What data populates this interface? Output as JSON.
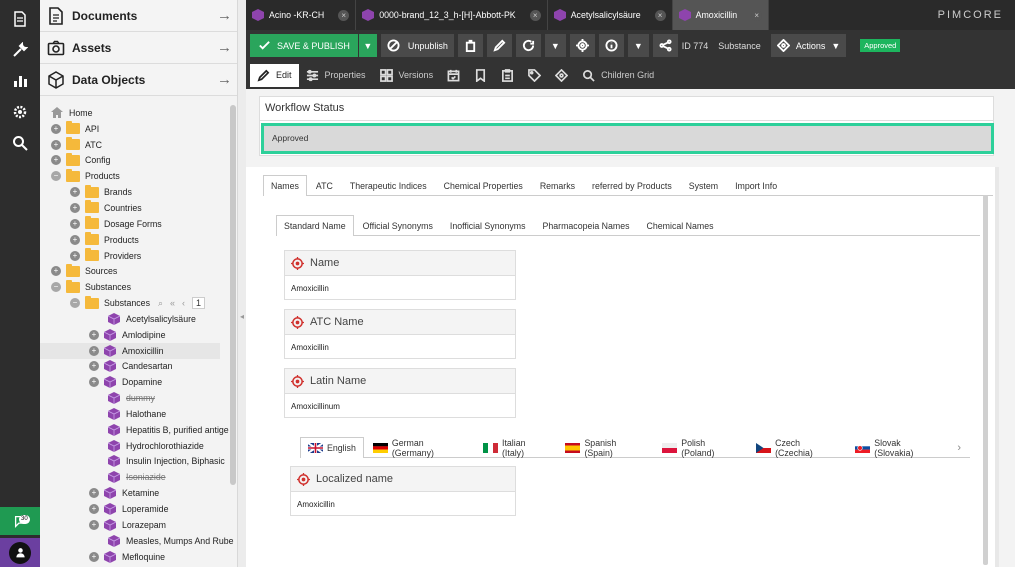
{
  "rail": {
    "notification_count": "30"
  },
  "tree": {
    "sections": [
      {
        "label": "Documents"
      },
      {
        "label": "Assets"
      },
      {
        "label": "Data Objects"
      }
    ],
    "nodes": [
      {
        "label": "Home"
      },
      {
        "label": "API"
      },
      {
        "label": "ATC"
      },
      {
        "label": "Config"
      },
      {
        "label": "Products"
      },
      {
        "label": "Brands"
      },
      {
        "label": "Countries"
      },
      {
        "label": "Dosage Forms"
      },
      {
        "label": "Products"
      },
      {
        "label": "Providers"
      },
      {
        "label": "Sources"
      },
      {
        "label": "Substances"
      },
      {
        "label": "Substances"
      },
      {
        "label": "Acetylsalicylsäure"
      },
      {
        "label": "Amlodipine"
      },
      {
        "label": "Amoxicillin"
      },
      {
        "label": "Candesartan"
      },
      {
        "label": "Dopamine"
      },
      {
        "label": "dummy"
      },
      {
        "label": "Halothane"
      },
      {
        "label": "Hepatitis B, purified antige"
      },
      {
        "label": "Hydrochlorothiazide"
      },
      {
        "label": "Insulin Injection, Biphasic"
      },
      {
        "label": "Isoniazide"
      },
      {
        "label": "Ketamine"
      },
      {
        "label": "Loperamide"
      },
      {
        "label": "Lorazepam"
      },
      {
        "label": "Measles, Mumps And Rube"
      },
      {
        "label": "Mefloquine"
      }
    ],
    "page": "1"
  },
  "tabs": [
    {
      "label": "Acino -KR-CH"
    },
    {
      "label": "0000-brand_12_3_h-[H]-Abbott-PK"
    },
    {
      "label": "Acetylsalicylsäure"
    },
    {
      "label": "Amoxicillin"
    }
  ],
  "logo": "PIMCORE",
  "toolbar": {
    "save_publish": "SAVE & PUBLISH",
    "unpublish": "Unpublish",
    "id": "ID 774",
    "class": "Substance",
    "actions": "Actions",
    "status": "Approved"
  },
  "edit_tabs": {
    "edit": "Edit",
    "properties": "Properties",
    "versions": "Versions",
    "children_grid": "Children Grid"
  },
  "workflow": {
    "title": "Workflow Status",
    "status": "Approved"
  },
  "main_tabs": [
    "Names",
    "ATC",
    "Therapeutic Indices",
    "Chemical Properties",
    "Remarks",
    "referred by Products",
    "System",
    "Import Info"
  ],
  "sub_tabs": [
    "Standard Name",
    "Official Synonyms",
    "Inofficial Synonyms",
    "Pharmacopeia Names",
    "Chemical Names"
  ],
  "fields": [
    {
      "label": "Name",
      "value": "Amoxicillin"
    },
    {
      "label": "ATC Name",
      "value": "Amoxicillin"
    },
    {
      "label": "Latin Name",
      "value": "Amoxicillinum"
    }
  ],
  "lang_tabs": [
    "English",
    "German (Germany)",
    "Italian (Italy)",
    "Spanish (Spain)",
    "Polish (Poland)",
    "Czech (Czechia)",
    "Slovak (Slovakia)"
  ],
  "localized": {
    "label": "Localized name",
    "value": "Amoxicillin"
  },
  "colors": {
    "accent_green": "#2aa55c",
    "workflow_border": "#2dd09a",
    "object_cube": "#8e44ad"
  }
}
